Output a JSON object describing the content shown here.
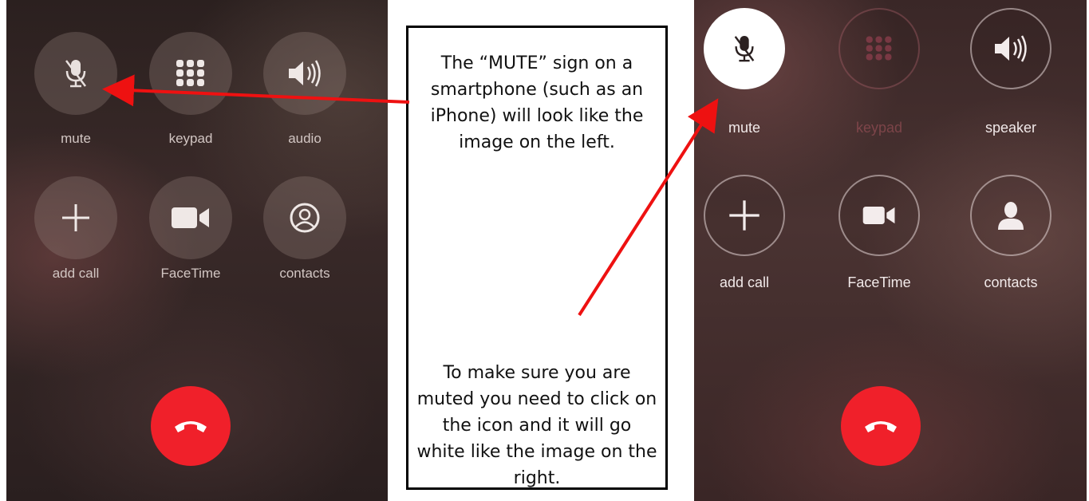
{
  "left_phone": {
    "buttons": [
      {
        "label": "mute",
        "icon": "mic-slash-icon"
      },
      {
        "label": "keypad",
        "icon": "keypad-icon"
      },
      {
        "label": "audio",
        "icon": "speaker-icon"
      },
      {
        "label": "add call",
        "icon": "plus-icon"
      },
      {
        "label": "FaceTime",
        "icon": "video-camera-icon"
      },
      {
        "label": "contacts",
        "icon": "contact-circle-icon"
      }
    ],
    "end_call_icon": "phone-hangup-icon"
  },
  "right_phone": {
    "buttons": [
      {
        "label": "mute",
        "icon": "mic-slash-icon",
        "state": "active"
      },
      {
        "label": "keypad",
        "icon": "keypad-icon",
        "state": "disabled"
      },
      {
        "label": "speaker",
        "icon": "speaker-icon"
      },
      {
        "label": "add call",
        "icon": "plus-icon"
      },
      {
        "label": "FaceTime",
        "icon": "video-camera-icon"
      },
      {
        "label": "contacts",
        "icon": "person-silhouette-icon"
      }
    ],
    "end_call_icon": "phone-hangup-icon"
  },
  "callout": {
    "top_text": "The “MUTE” sign on a smartphone (such as an iPhone) will look like the image on the left.",
    "bottom_text": "To make sure you are muted you need to click on the icon and it will go white like the image on the right."
  },
  "colors": {
    "end_call": "#f0202a",
    "arrow": "#ee1111",
    "active_button": "#ffffff"
  }
}
